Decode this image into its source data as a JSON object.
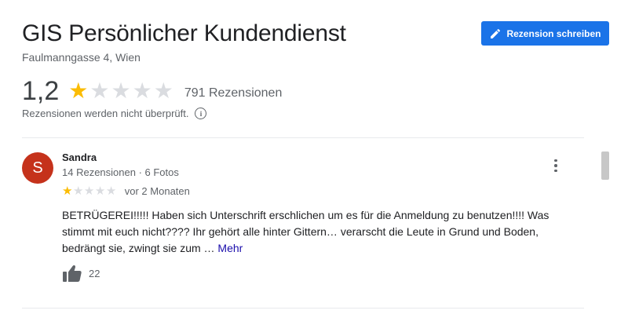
{
  "header": {
    "title": "GIS Persönlicher Kundendienst",
    "address": "Faulmanngasse 4, Wien",
    "write_review_label": "Rezension schreiben"
  },
  "summary": {
    "rating": "1,2",
    "stars_filled": 1,
    "stars_total": 5,
    "review_count": "791 Rezensionen",
    "not_verified": "Rezensionen werden nicht überprüft."
  },
  "review": {
    "avatar_letter": "S",
    "name": "Sandra",
    "meta": "14 Rezensionen · 6 Fotos",
    "stars_filled": 1,
    "stars_total": 5,
    "date": "vor 2 Monaten",
    "text": "BETRÜGEREI!!!!! Haben sich Unterschrift erschlichen um es für die Anmeldung zu benutzen!!!! Was stimmt mit euch nicht???? Ihr gehört alle hinter Gittern… verarscht die Leute in Grund und Boden, bedrängt sie, zwingt sie zum …",
    "more_label": "Mehr",
    "likes": "22"
  },
  "icons": {
    "write": "pencil-icon",
    "info": "info-icon",
    "like": "thumbs-up-icon",
    "menu": "more-vert-icon"
  },
  "colors": {
    "accent": "#1a73e8",
    "star_filled": "#fbbc04",
    "star_empty": "#dadce0",
    "avatar": "#c5321b",
    "link": "#1a0dab"
  }
}
